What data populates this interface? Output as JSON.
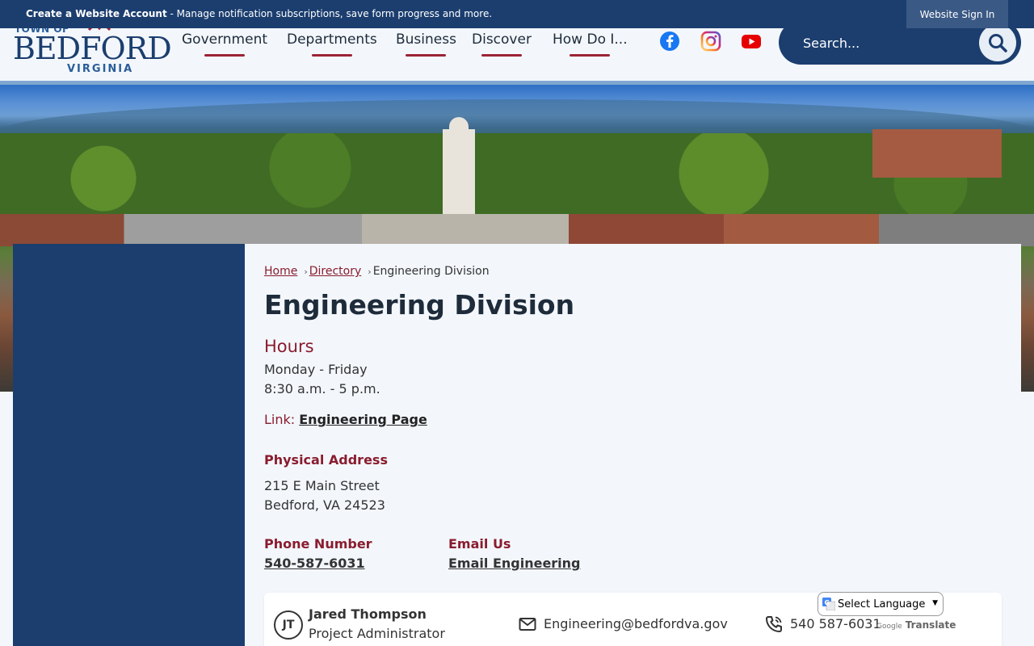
{
  "topbar": {
    "account_bold": "Create a Website Account",
    "account_rest": " - Manage notification subscriptions, save form progress and more.",
    "signin": "Website Sign In"
  },
  "logo": {
    "town_of": "TOWN OF",
    "name": "BEDFORD",
    "state": "VIRGINIA"
  },
  "nav": {
    "items": [
      "Government",
      "Departments",
      "Business",
      "Discover",
      "How Do I..."
    ]
  },
  "social": [
    "facebook-icon",
    "instagram-icon",
    "youtube-icon"
  ],
  "search": {
    "placeholder": "Search..."
  },
  "breadcrumb": {
    "home": "Home",
    "directory": "Directory",
    "current": "Engineering Division"
  },
  "page": {
    "title": "Engineering Division",
    "hours_heading": "Hours",
    "hours_days": "Monday - Friday",
    "hours_time": "8:30 a.m. - 5 p.m.",
    "link_label": "Link:",
    "link_text": "Engineering Page",
    "address_heading": "Physical Address",
    "address_line1": "215 E Main Street",
    "address_line2": "Bedford, VA 24523",
    "phone_heading": "Phone Number",
    "phone_value": "540-587-6031",
    "email_heading": "Email Us",
    "email_value": "Email Engineering"
  },
  "contact": {
    "initials": "JT",
    "name": "Jared Thompson",
    "title": "Project Administrator",
    "email": "Engineering@bedfordva.gov",
    "phone": "540 587-6031"
  },
  "translate": {
    "select_label": "Select Language",
    "powered_by": "Google",
    "translate_word": "Translate"
  },
  "colors": {
    "navy": "#1b3e6f",
    "maroon": "#8a1c2e",
    "background": "#f3f7fc"
  }
}
